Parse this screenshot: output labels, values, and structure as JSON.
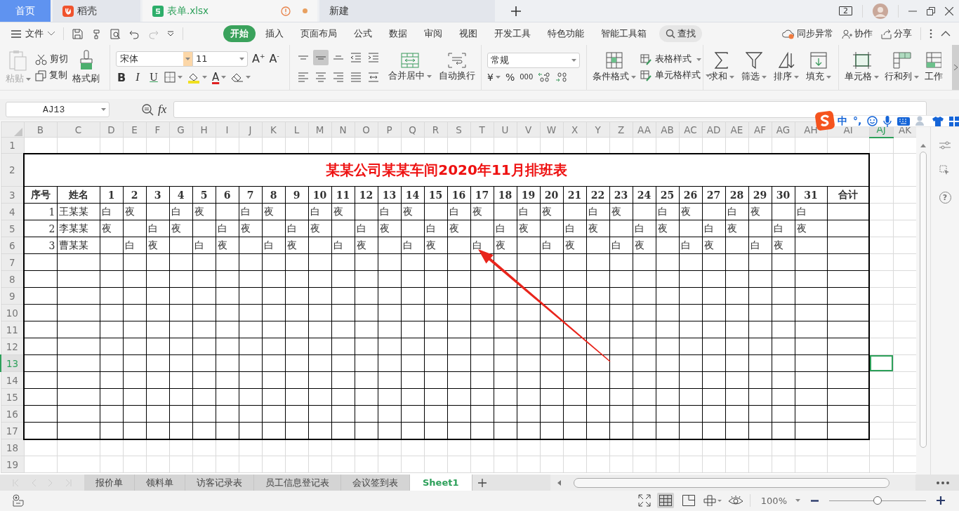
{
  "tabs": [
    {
      "label": "首页",
      "kind": "home",
      "selected": false
    },
    {
      "label": "稻壳",
      "kind": "docer",
      "selected": false
    },
    {
      "label": "表单.xlsx",
      "kind": "sheet",
      "selected": true,
      "warning": true,
      "modified": true
    },
    {
      "label": "新建",
      "kind": "new",
      "selected": false
    }
  ],
  "window_count": "2",
  "menu": {
    "file": "文件",
    "tabs": [
      {
        "label": "开始",
        "selected": true
      },
      {
        "label": "插入",
        "selected": false
      },
      {
        "label": "页面布局",
        "selected": false
      },
      {
        "label": "公式",
        "selected": false
      },
      {
        "label": "数据",
        "selected": false
      },
      {
        "label": "审阅",
        "selected": false
      },
      {
        "label": "视图",
        "selected": false
      },
      {
        "label": "开发工具",
        "selected": false
      },
      {
        "label": "特色功能",
        "selected": false
      },
      {
        "label": "智能工具箱",
        "selected": false
      }
    ],
    "search": "查找",
    "actions": [
      "同步异常",
      "协作",
      "分享"
    ]
  },
  "ribbon": {
    "clipboard": [
      {
        "label": "粘贴",
        "disabled": true,
        "dropdown": true
      },
      {
        "label": "剪切",
        "disabled": false,
        "dropdown": false
      },
      {
        "label": "复制",
        "disabled": false,
        "dropdown": false
      },
      {
        "label": "格式刷",
        "disabled": false,
        "dropdown": false
      }
    ],
    "font": {
      "name": "宋体",
      "size": "11",
      "grow": "A$^{+}$",
      "shrink": "A$^{-}$",
      "styles": [
        "B",
        "I",
        "U"
      ],
      "color_label": "A"
    },
    "vertical_align": [
      {
        "selected": false
      },
      {
        "selected": true
      },
      {
        "selected": false
      }
    ],
    "align": [
      {
        "label": "合并居中",
        "dropdown": true
      },
      {
        "label": "自动换行",
        "dropdown": false
      }
    ],
    "number": {
      "format": "常规",
      "currency": "¥",
      "percent": "%",
      "thousands": "000"
    },
    "styles": [
      {
        "label": "条件格式",
        "dropdown": true
      },
      {
        "label": "表格样式",
        "dropdown": true
      },
      {
        "label": "单元格样式",
        "dropdown": true
      }
    ],
    "editing": [
      {
        "label": "求和",
        "dropdown": true
      },
      {
        "label": "筛选",
        "dropdown": true
      },
      {
        "label": "排序",
        "dropdown": true
      },
      {
        "label": "填充",
        "dropdown": true
      }
    ],
    "cells": [
      {
        "label": "单元格",
        "dropdown": true
      },
      {
        "label": "行和列",
        "dropdown": true
      },
      {
        "label": "工作",
        "dropdown": false
      }
    ]
  },
  "formula_bar": {
    "name_box": "AJ13",
    "fx": "fx"
  },
  "ime_bar": {
    "mode": "中",
    "punctuation": "°,"
  },
  "sheet": {
    "columns": [
      {
        "label": "B",
        "selected": false
      },
      {
        "label": "C",
        "selected": false
      },
      {
        "label": "D",
        "selected": false
      },
      {
        "label": "E",
        "selected": false
      },
      {
        "label": "F",
        "selected": false
      },
      {
        "label": "G",
        "selected": false
      },
      {
        "label": "H",
        "selected": false
      },
      {
        "label": "I",
        "selected": false
      },
      {
        "label": "J",
        "selected": false
      },
      {
        "label": "K",
        "selected": false
      },
      {
        "label": "L",
        "selected": false
      },
      {
        "label": "M",
        "selected": false
      },
      {
        "label": "N",
        "selected": false
      },
      {
        "label": "O",
        "selected": false
      },
      {
        "label": "P",
        "selected": false
      },
      {
        "label": "Q",
        "selected": false
      },
      {
        "label": "R",
        "selected": false
      },
      {
        "label": "S",
        "selected": false
      },
      {
        "label": "T",
        "selected": false
      },
      {
        "label": "U",
        "selected": false
      },
      {
        "label": "V",
        "selected": false
      },
      {
        "label": "W",
        "selected": false
      },
      {
        "label": "X",
        "selected": false
      },
      {
        "label": "Y",
        "selected": false
      },
      {
        "label": "Z",
        "selected": false
      },
      {
        "label": "AA",
        "selected": false
      },
      {
        "label": "AB",
        "selected": false
      },
      {
        "label": "AC",
        "selected": false
      },
      {
        "label": "AD",
        "selected": false
      },
      {
        "label": "AE",
        "selected": false
      },
      {
        "label": "AF",
        "selected": false
      },
      {
        "label": "AG",
        "selected": false
      },
      {
        "label": "AH",
        "selected": false
      },
      {
        "label": "AI",
        "selected": false
      },
      {
        "label": "AJ",
        "selected": true
      },
      {
        "label": "AK",
        "selected": false
      }
    ],
    "rows": [
      {
        "label": "1",
        "selected": false
      },
      {
        "label": "2",
        "selected": false
      },
      {
        "label": "3",
        "selected": false
      },
      {
        "label": "4",
        "selected": false
      },
      {
        "label": "5",
        "selected": false
      },
      {
        "label": "6",
        "selected": false
      },
      {
        "label": "7",
        "selected": false
      },
      {
        "label": "8",
        "selected": false
      },
      {
        "label": "9",
        "selected": false
      },
      {
        "label": "10",
        "selected": false
      },
      {
        "label": "11",
        "selected": false
      },
      {
        "label": "12",
        "selected": false
      },
      {
        "label": "13",
        "selected": true
      },
      {
        "label": "14",
        "selected": false
      },
      {
        "label": "15",
        "selected": false
      },
      {
        "label": "16",
        "selected": false
      },
      {
        "label": "17",
        "selected": false
      },
      {
        "label": "18",
        "selected": false
      },
      {
        "label": "19",
        "selected": false
      }
    ],
    "title": "某某公司某某车间2020年11月排班表",
    "header": [
      "序号",
      "姓名",
      "1",
      "2",
      "3",
      "4",
      "5",
      "6",
      "7",
      "8",
      "9",
      "10",
      "11",
      "12",
      "13",
      "14",
      "15",
      "16",
      "17",
      "18",
      "19",
      "20",
      "21",
      "22",
      "23",
      "24",
      "25",
      "26",
      "27",
      "28",
      "29",
      "30",
      "31",
      "合计"
    ],
    "records": [
      {
        "no": "1",
        "name": "王某某",
        "shifts": {
          "1": "白",
          "2": "夜",
          "4": "白",
          "5": "夜",
          "7": "白",
          "8": "夜",
          "10": "白",
          "11": "夜",
          "13": "白",
          "14": "夜",
          "16": "白",
          "17": "夜",
          "19": "白",
          "20": "夜",
          "22": "白",
          "23": "夜",
          "25": "白",
          "26": "夜",
          "28": "白",
          "29": "夜",
          "31": "白"
        }
      },
      {
        "no": "2",
        "name": "李某某",
        "shifts": {
          "1": "夜",
          "3": "白",
          "4": "夜",
          "6": "白",
          "7": "夜",
          "9": "白",
          "10": "夜",
          "12": "白",
          "13": "夜",
          "15": "白",
          "16": "夜",
          "18": "白",
          "19": "夜",
          "21": "白",
          "22": "夜",
          "24": "白",
          "25": "夜",
          "27": "白",
          "28": "夜",
          "30": "白",
          "31": "夜"
        }
      },
      {
        "no": "3",
        "name": "曹某某",
        "shifts": {
          "2": "白",
          "3": "夜",
          "5": "白",
          "6": "夜",
          "8": "白",
          "9": "夜",
          "11": "白",
          "12": "夜",
          "14": "白",
          "15": "夜",
          "17": "白",
          "18": "夜",
          "20": "白",
          "21": "夜",
          "23": "白",
          "24": "夜",
          "26": "白",
          "27": "夜",
          "29": "白",
          "30": "夜"
        }
      }
    ]
  },
  "side_panel": {
    "help": "?"
  },
  "sheet_tabs": [
    {
      "label": "报价单",
      "selected": false
    },
    {
      "label": "领料单",
      "selected": false
    },
    {
      "label": "访客记录表",
      "selected": false
    },
    {
      "label": "员工信息登记表",
      "selected": false
    },
    {
      "label": "会议签到表",
      "selected": false
    },
    {
      "label": "Sheet1",
      "selected": true
    }
  ],
  "status_bar": {
    "views": [
      {
        "selected": true
      },
      {
        "selected": false
      }
    ],
    "zoom": "100%",
    "zoom_slider": {
      "level": 0.5
    }
  }
}
